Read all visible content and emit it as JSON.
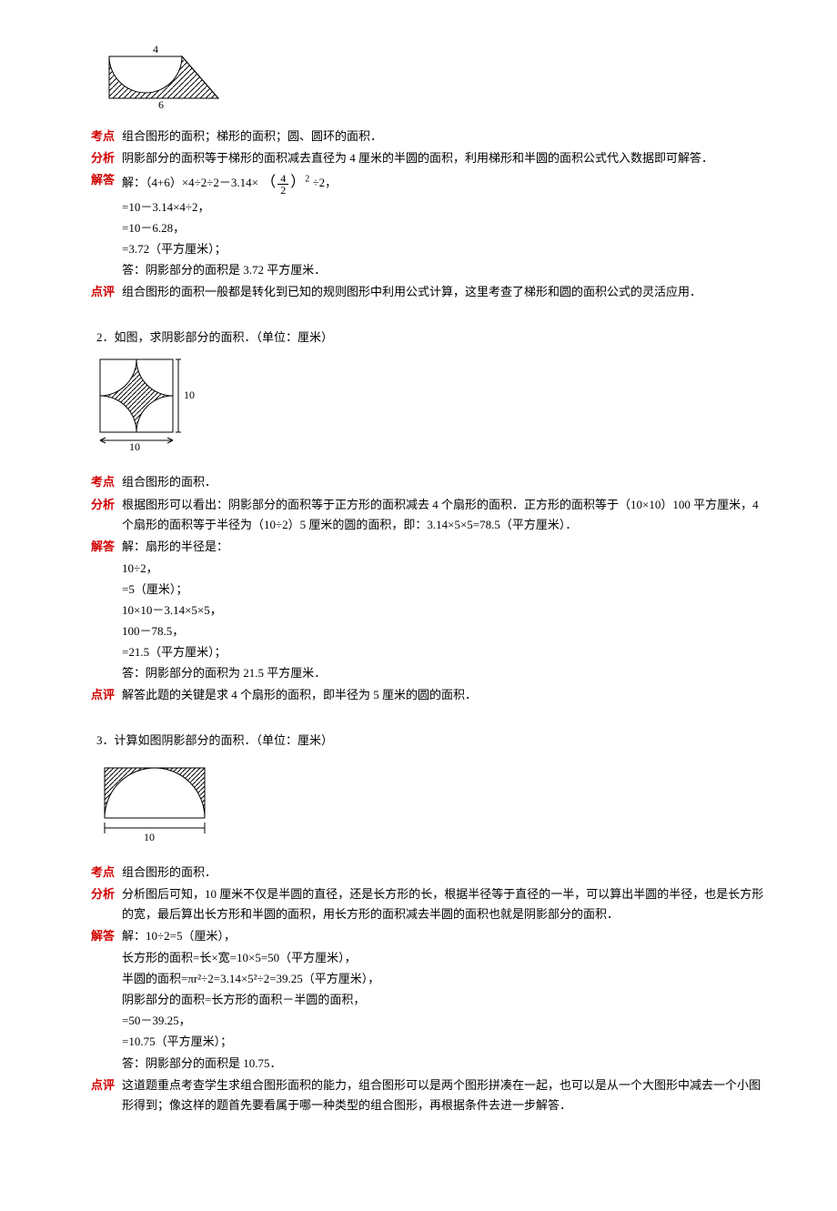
{
  "labels": {
    "kaodian": "考点",
    "fenxi": "分析",
    "jieda": "解答",
    "dianping": "点评"
  },
  "p1": {
    "fig": {
      "top": "4",
      "bottom": "6"
    },
    "kaodian": "组合图形的面积；梯形的面积；圆、圆环的面积．",
    "fenxi": "阴影部分的面积等于梯形的面积减去直径为 4 厘米的半圆的面积，利用梯形和半圆的面积公式代入数据即可解答．",
    "jieda_head_pre": "解：（4+6）×4÷2÷2－3.14×",
    "jieda_head_frac_num": "4",
    "jieda_head_frac_den": "2",
    "jieda_head_post": "÷2，",
    "jieda_lines": [
      "=10－3.14×4÷2，",
      "=10－6.28，",
      "=3.72（平方厘米）；",
      "答：阴影部分的面积是 3.72 平方厘米．"
    ],
    "dianping": "组合图形的面积一般都是转化到已知的规则图形中利用公式计算，这里考查了梯形和圆的面积公式的灵活应用．"
  },
  "p2": {
    "title": "2．如图，求阴影部分的面积．（单位：厘米）",
    "fig": {
      "right": "10",
      "bottom": "10"
    },
    "kaodian": "组合图形的面积．",
    "fenxi": "根据图形可以看出：阴影部分的面积等于正方形的面积减去 4 个扇形的面积．正方形的面积等于（10×10）100 平方厘米，4 个扇形的面积等于半径为（10÷2）5 厘米的圆的面积，即：3.14×5×5=78.5（平方厘米）．",
    "jieda_lines": [
      "解：扇形的半径是：",
      "10÷2，",
      "=5（厘米）；",
      "10×10－3.14×5×5，",
      "100－78.5，",
      "=21.5（平方厘米）；",
      "答：阴影部分的面积为 21.5 平方厘米．"
    ],
    "dianping": "解答此题的关键是求 4 个扇形的面积，即半径为 5 厘米的圆的面积．"
  },
  "p3": {
    "title": "3．计算如图阴影部分的面积．（单位：厘米）",
    "fig": {
      "bottom": "10"
    },
    "kaodian": "组合图形的面积．",
    "fenxi": "分析图后可知，10 厘米不仅是半圆的直径，还是长方形的长，根据半径等于直径的一半，可以算出半圆的半径，也是长方形的宽，最后算出长方形和半圆的面积，用长方形的面积减去半圆的面积也就是阴影部分的面积．",
    "jieda_lines": [
      "解：10÷2=5（厘米），",
      "长方形的面积=长×宽=10×5=50（平方厘米），",
      "半圆的面积=πr²÷2=3.14×5²÷2=39.25（平方厘米），",
      "阴影部分的面积=长方形的面积－半圆的面积，",
      "=50－39.25，",
      "=10.75（平方厘米）；",
      "答：阴影部分的面积是 10.75．"
    ],
    "dianping": "这道题重点考查学生求组合图形面积的能力，组合图形可以是两个图形拼凑在一起，也可以是从一个大图形中减去一个小图形得到；像这样的题首先要看属于哪一种类型的组合图形，再根据条件去进一步解答．"
  }
}
